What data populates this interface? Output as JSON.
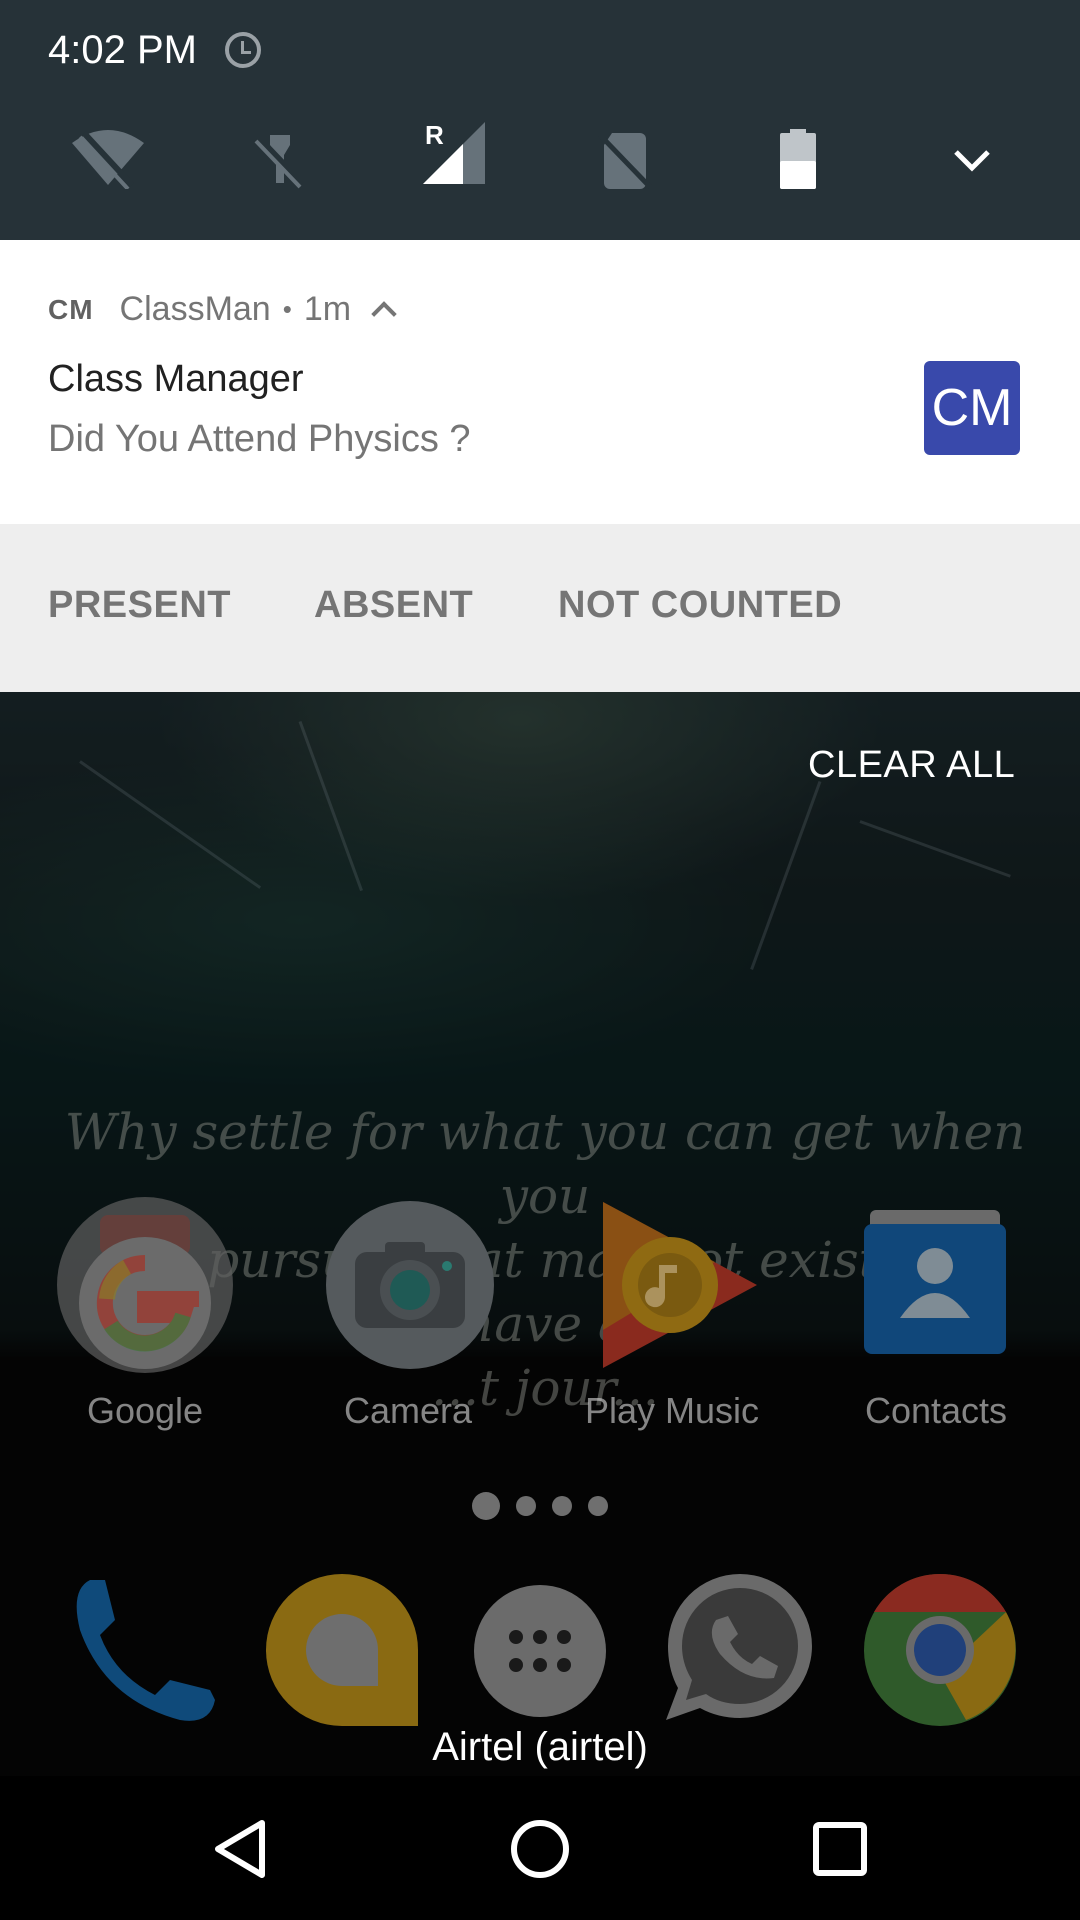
{
  "status_bar": {
    "time": "4:02 PM",
    "icons": [
      "alarm-icon",
      "wifi-off-icon",
      "flashlight-off-icon",
      "signal-roaming-icon",
      "no-sim-icon",
      "battery-icon",
      "expand-chevron-icon"
    ],
    "roaming_indicator": "R",
    "battery_level": 0.5
  },
  "notification": {
    "app_badge": "CM",
    "app_name": "ClassMan",
    "separator": "•",
    "age": "1m",
    "title": "Class Manager",
    "text": "Did You Attend Physics ?",
    "large_icon_text": "CM",
    "accent_color": "#3949ab",
    "actions": [
      "PRESENT",
      "ABSENT",
      "NOT COUNTED"
    ]
  },
  "clear_all_label": "CLEAR ALL",
  "wallpaper": {
    "quote": "Why settle for what you can get when you\ncan pursue what may not exist and have a\n...t jour..."
  },
  "home": {
    "apps": [
      {
        "label": "Google",
        "icon": "google-icon"
      },
      {
        "label": "Camera",
        "icon": "camera-icon"
      },
      {
        "label": "Play Music",
        "icon": "play-music-icon"
      },
      {
        "label": "Contacts",
        "icon": "contacts-icon"
      }
    ],
    "page_count": 4,
    "active_page": 1,
    "dock": [
      "phone-icon",
      "allo-icon",
      "app-drawer-icon",
      "whatsapp-icon",
      "chrome-icon"
    ]
  },
  "carrier": "Airtel (airtel)",
  "nav": [
    "back-icon",
    "home-icon",
    "recents-icon"
  ]
}
